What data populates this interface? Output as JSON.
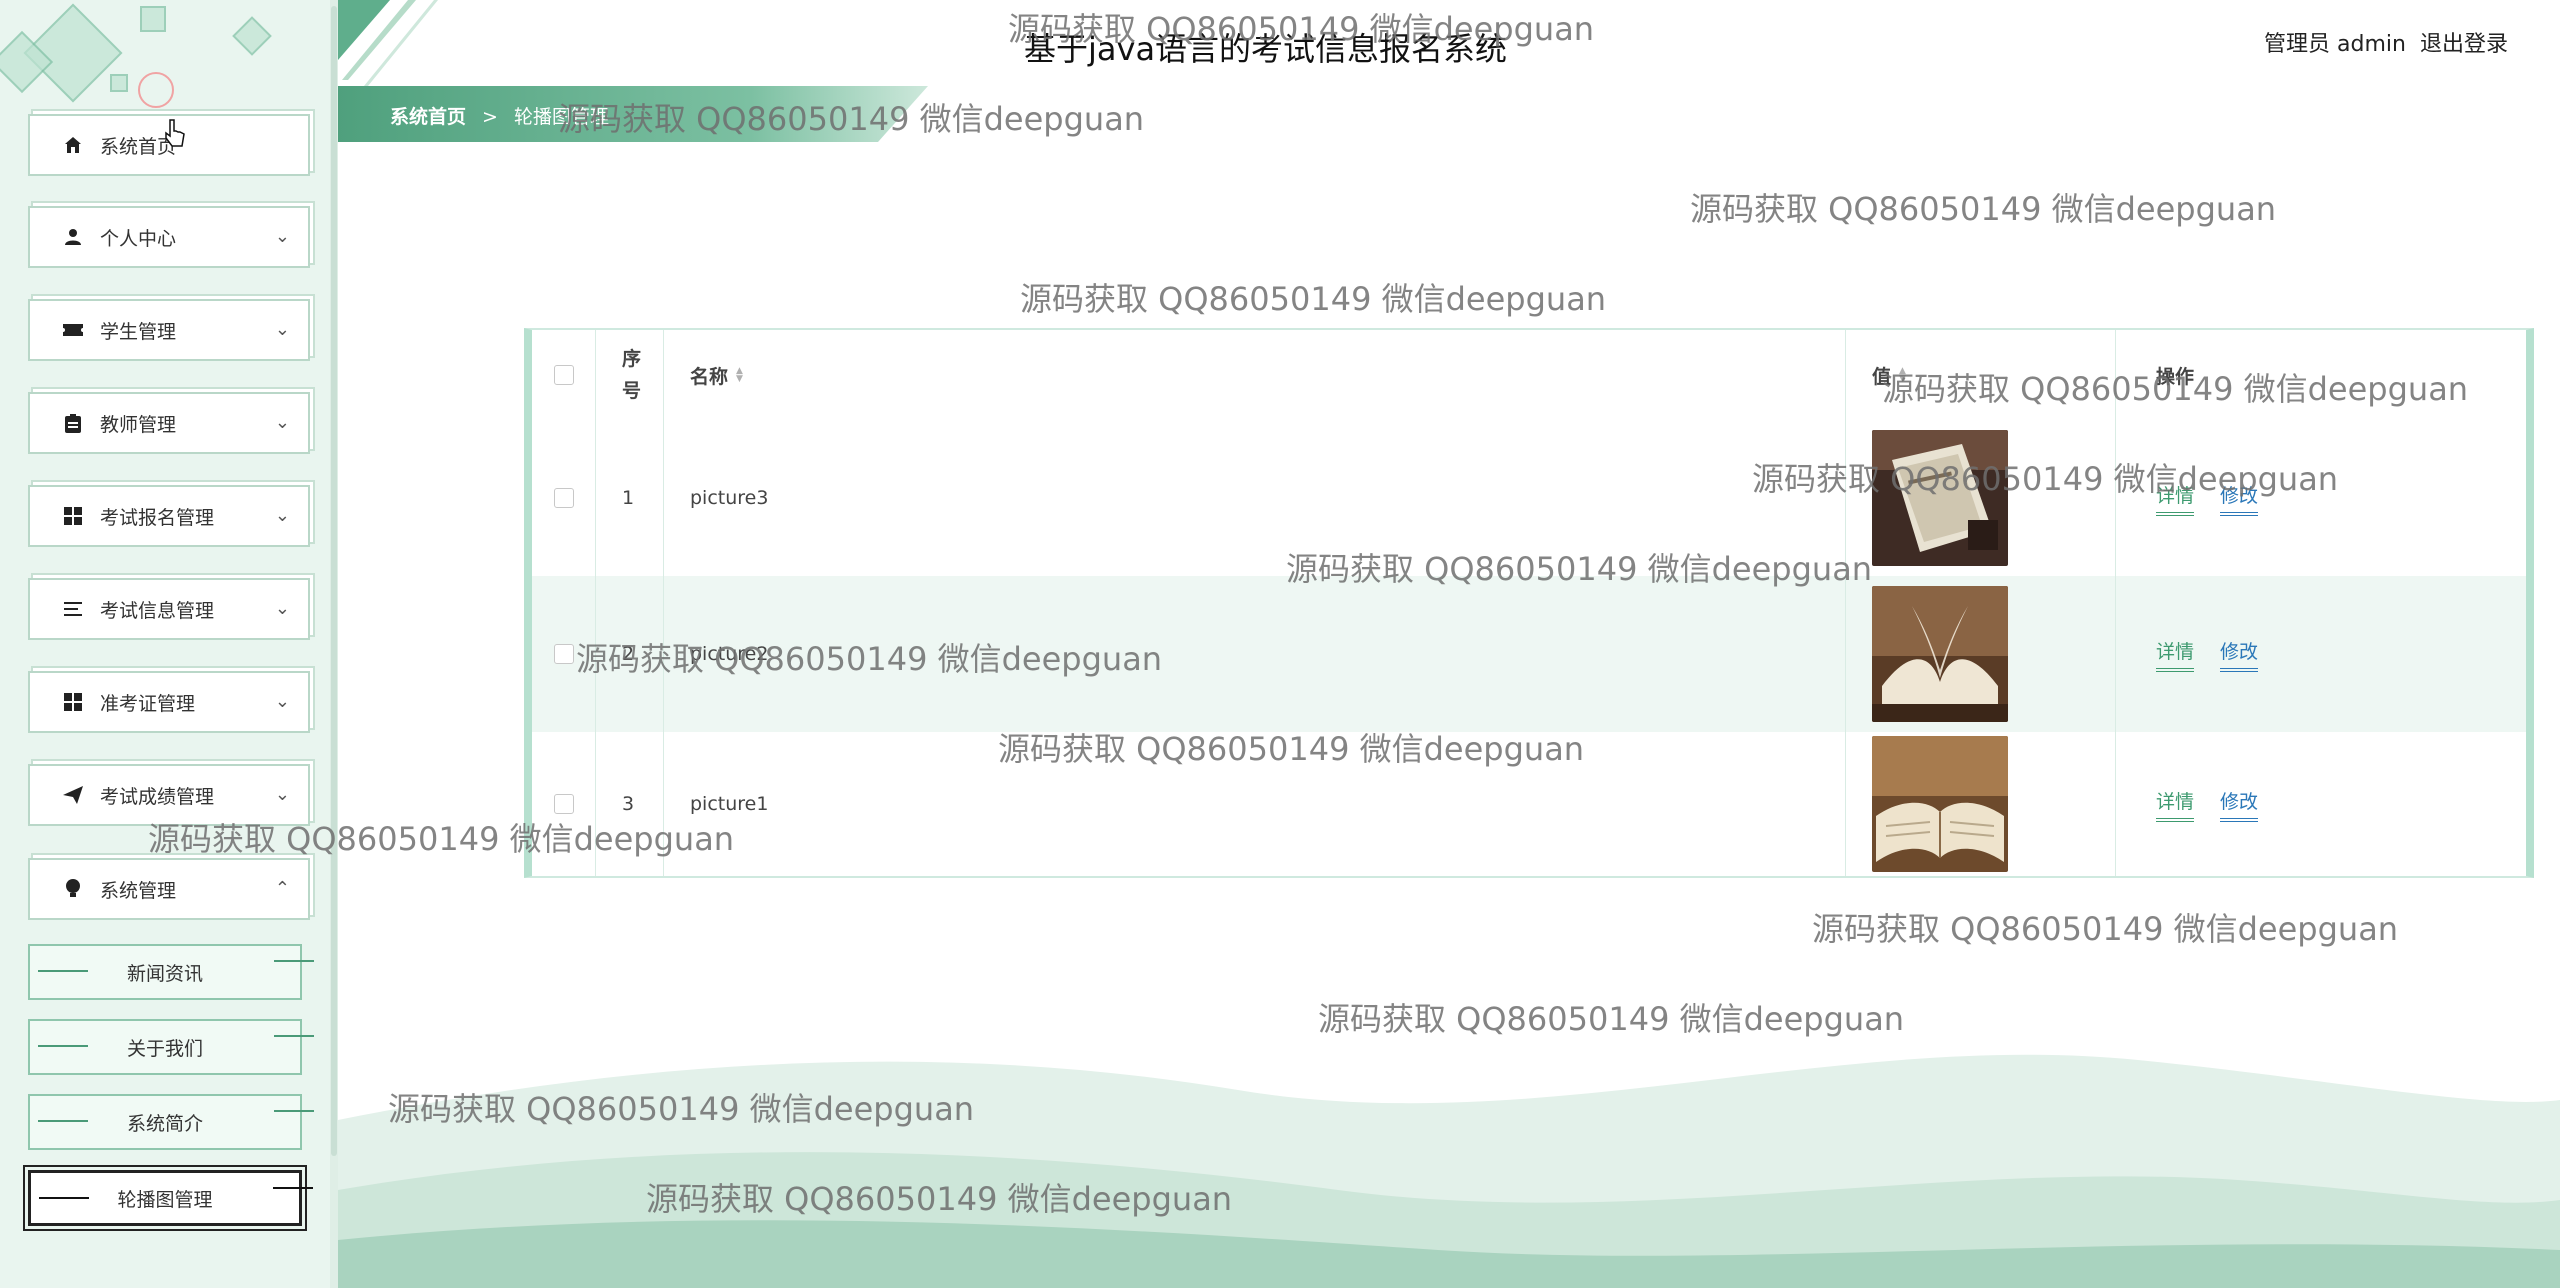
{
  "app": {
    "title": "基于java语言的考试信息报名系统",
    "user_label": "管理员 admin",
    "logout_label": "退出登录"
  },
  "breadcrumb": {
    "home": "系统首页",
    "separator": ">",
    "current": "轮播图管理"
  },
  "sidebar": {
    "items": [
      {
        "label": "系统首页",
        "icon": "home-icon"
      },
      {
        "label": "个人中心",
        "icon": "user-icon"
      },
      {
        "label": "学生管理",
        "icon": "ticket-icon"
      },
      {
        "label": "教师管理",
        "icon": "clipboard-icon"
      },
      {
        "label": "考试报名管理",
        "icon": "grid-icon"
      },
      {
        "label": "考试信息管理",
        "icon": "list-icon"
      },
      {
        "label": "准考证管理",
        "icon": "grid-icon"
      },
      {
        "label": "考试成绩管理",
        "icon": "send-icon"
      },
      {
        "label": "系统管理",
        "icon": "bulb-icon"
      }
    ],
    "sub_items": [
      {
        "label": "新闻资讯"
      },
      {
        "label": "关于我们"
      },
      {
        "label": "系统简介"
      },
      {
        "label": "轮播图管理",
        "active": true
      }
    ]
  },
  "table": {
    "headers": {
      "checkbox": "",
      "index": "序号",
      "name": "名称",
      "value": "值",
      "actions": "操作"
    },
    "rows": [
      {
        "index": "1",
        "name": "picture3",
        "image": "book-dark"
      },
      {
        "index": "2",
        "name": "picture2",
        "image": "book-open-warm"
      },
      {
        "index": "3",
        "name": "picture1",
        "image": "book-open-brown"
      }
    ],
    "detail_label": "详情",
    "edit_label": "修改"
  },
  "watermark": {
    "text": "源码获取 QQ86050149 微信deepguan"
  },
  "colors": {
    "accent": "#5fae8c",
    "link_green": "#3d9a6f",
    "link_blue": "#2a77b8",
    "sidebar_bg": "#e9f5ef"
  }
}
